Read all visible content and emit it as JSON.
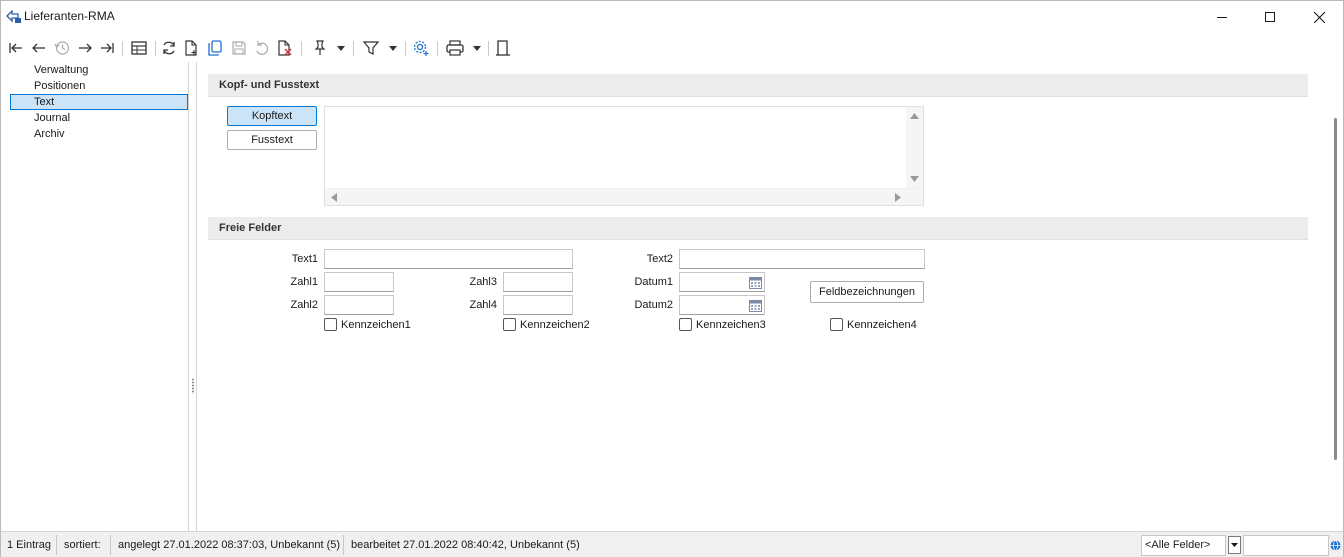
{
  "window": {
    "title": "Lieferanten-RMA",
    "app_icon": "rma-app-icon",
    "controls": [
      "minimize-icon",
      "maximize-icon",
      "close-icon"
    ]
  },
  "toolbar": {
    "icons": [
      "first-record-icon",
      "previous-record-icon",
      "history-icon",
      "next-record-icon",
      "last-record-icon",
      "table-view-icon",
      "refresh-icon",
      "new-document-icon",
      "copy-icon",
      "save-icon",
      "undo-icon",
      "delete-document-icon",
      "pin-icon",
      "filter-icon",
      "settings-icon",
      "print-icon",
      "export-icon"
    ]
  },
  "tree": {
    "items": [
      {
        "label": "Verwaltung",
        "selected": false
      },
      {
        "label": "Positionen",
        "selected": false
      },
      {
        "label": "Text",
        "selected": true
      },
      {
        "label": "Journal",
        "selected": false
      },
      {
        "label": "Archiv",
        "selected": false
      }
    ]
  },
  "sections": {
    "header_footer": {
      "title": "Kopf- und Fusstext",
      "buttons": {
        "header": "Kopftext",
        "footer": "Fusstext"
      },
      "active": "Kopftext",
      "memo_value": ""
    },
    "free_fields": {
      "title": "Freie Felder",
      "labels": {
        "text1": "Text1",
        "text2": "Text2",
        "zahl1": "Zahl1",
        "zahl2": "Zahl2",
        "zahl3": "Zahl3",
        "zahl4": "Zahl4",
        "datum1": "Datum1",
        "datum2": "Datum2"
      },
      "values": {
        "text1": "",
        "text2": "",
        "zahl1": "",
        "zahl2": "",
        "zahl3": "",
        "zahl4": "",
        "datum1": "",
        "datum2": ""
      },
      "checkboxes": [
        {
          "label": "Kennzeichen1",
          "checked": false
        },
        {
          "label": "Kennzeichen2",
          "checked": false
        },
        {
          "label": "Kennzeichen3",
          "checked": false
        },
        {
          "label": "Kennzeichen4",
          "checked": false
        }
      ],
      "field_names_button": "Feldbezeichnungen"
    }
  },
  "statusbar": {
    "count": "1 Eintrag",
    "sorted": "sortiert:",
    "created": "angelegt 27.01.2022 08:37:03, Unbekannt (5)",
    "edited": "bearbeitet 27.01.2022 08:40:42, Unbekannt (5)",
    "field_filter": "<Alle Felder>",
    "search_value": ""
  },
  "colors": {
    "accent": "#0078d7",
    "selection": "#cce4f7",
    "section_header": "#ececec",
    "status_globe": "#1f6fd1"
  }
}
